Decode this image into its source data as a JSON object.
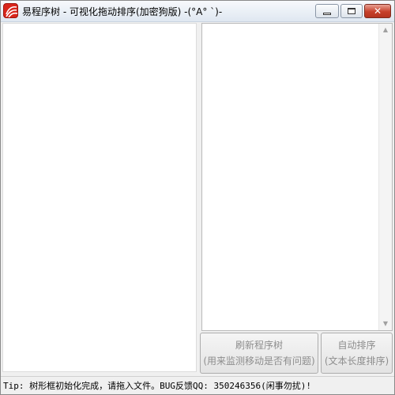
{
  "window": {
    "title": "易程序树 - 可视化拖动排序(加密狗版) -(°A° `)-",
    "icon": "app-logo-icon",
    "controls": {
      "minimize_icon": "minimize-icon",
      "maximize_icon": "maximize-icon",
      "close_glyph": "✕"
    }
  },
  "buttons": {
    "refresh": {
      "line1": "刷新程序树",
      "line2": "(用来监测移动是否有问题)"
    },
    "auto_sort": {
      "line1": "自动排序",
      "line2": "(文本长度排序)"
    }
  },
  "scrollbar": {
    "up": "▲",
    "down": "▼"
  },
  "status": {
    "text": "Tip: 树形框初始化完成，请拖入文件。BUG反馈QQ: 350246356(闲事勿扰)!"
  },
  "colors": {
    "icon_red": "#d9261c",
    "close_red": "#c7402a",
    "disabled_text": "#8d8d8d"
  }
}
